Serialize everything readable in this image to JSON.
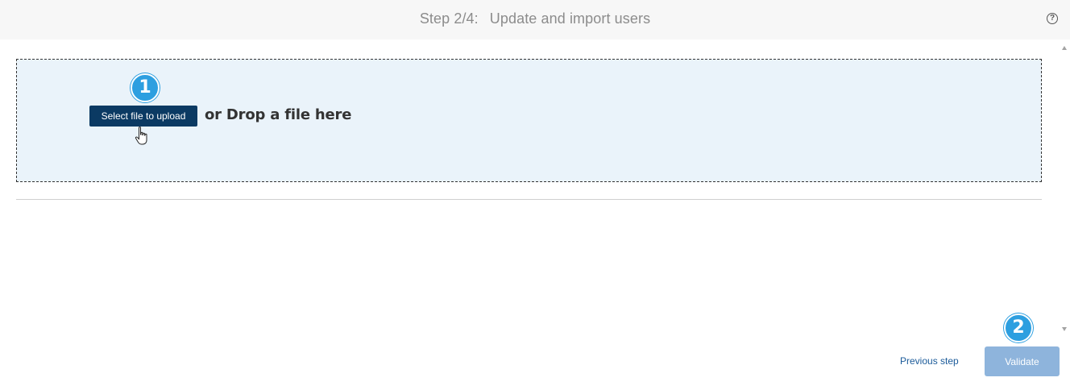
{
  "header": {
    "step": "Step 2/4:",
    "title": "Update and import users",
    "help_icon": "question-circle-icon",
    "help_glyph": "?"
  },
  "upload": {
    "button_label": "Select file to upload",
    "drop_text": "or Drop a file here"
  },
  "annotations": {
    "badge_1": "1",
    "badge_2": "2"
  },
  "footer": {
    "previous_label": "Previous step",
    "validate_label": "Validate"
  },
  "colors": {
    "primary_button": "#0b3a63",
    "disabled_button": "#8eb4dc",
    "dropzone_bg": "#eaf3fa",
    "badge": "#2d9fe0",
    "link": "#1a5a99"
  }
}
